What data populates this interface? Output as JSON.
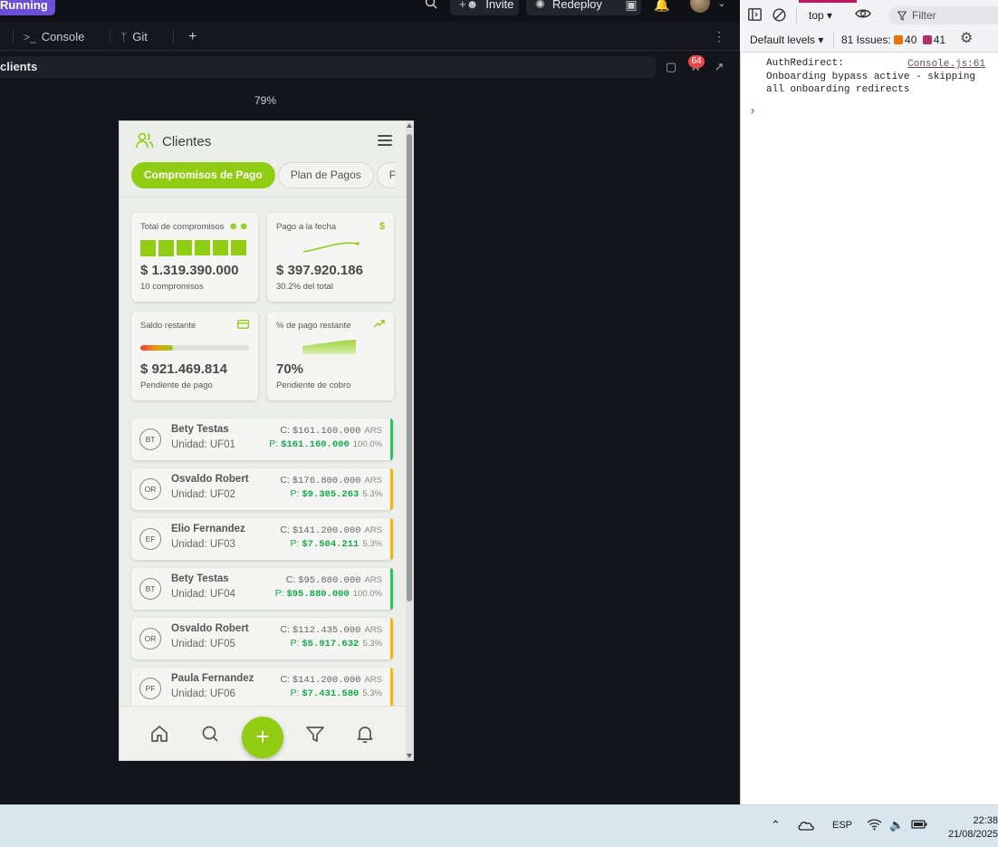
{
  "topbar": {
    "status": "Running",
    "invite_label": "Invite",
    "redeploy_label": "Redeploy"
  },
  "tabs": [
    {
      "label": "Console",
      "icon": "terminal-icon"
    },
    {
      "label": "Git",
      "icon": "git-icon"
    }
  ],
  "url": {
    "path": "clients",
    "badge_count": "64"
  },
  "preview": {
    "zoom": "79%"
  },
  "app": {
    "title": "Clientes",
    "brand_color": "#8fcc12",
    "pills": [
      "Compromisos de Pago",
      "Plan de Pagos",
      "Pag"
    ],
    "cards": {
      "total": {
        "label": "Total de compromisos",
        "value": "$ 1.319.390.000",
        "sub": "10 compromisos",
        "squares": 6
      },
      "paid": {
        "label": "Pago a la fecha",
        "value": "$ 397.920.186",
        "sub": "30.2% del total"
      },
      "remaining": {
        "label": "Saldo restante",
        "value": "$ 921.469.814",
        "sub": "Pendiente de pago",
        "progress_fraction": 0.3
      },
      "percent": {
        "label": "% de pago restante",
        "value": "70%",
        "sub": "Pendiente de cobro"
      }
    },
    "clients": [
      {
        "initials": "BT",
        "name": "Bety Testas",
        "unit": "Unidad: UF01",
        "c_label": "C:",
        "c_value": "$161.160.000",
        "currency": "ARS",
        "p_label": "P:",
        "p_value": "$161.160.000",
        "pct": "100.0%",
        "status_color": "#22c55e"
      },
      {
        "initials": "OR",
        "name": "Osvaldo Robert",
        "unit": "Unidad: UF02",
        "c_label": "C:",
        "c_value": "$176.800.000",
        "currency": "ARS",
        "p_label": "P:",
        "p_value": "$9.305.263",
        "pct": "5.3%",
        "status_color": "#f5b700"
      },
      {
        "initials": "EF",
        "name": "Elio Fernandez",
        "unit": "Unidad: UF03",
        "c_label": "C:",
        "c_value": "$141.200.000",
        "currency": "ARS",
        "p_label": "P:",
        "p_value": "$7.504.211",
        "pct": "5.3%",
        "status_color": "#f5b700"
      },
      {
        "initials": "BT",
        "name": "Bety Testas",
        "unit": "Unidad: UF04",
        "c_label": "C:",
        "c_value": "$95.880.000",
        "currency": "ARS",
        "p_label": "P:",
        "p_value": "$95.880.000",
        "pct": "100.0%",
        "status_color": "#22c55e"
      },
      {
        "initials": "OR",
        "name": "Osvaldo Robert",
        "unit": "Unidad: UF05",
        "c_label": "C:",
        "c_value": "$112.435.000",
        "currency": "ARS",
        "p_label": "P:",
        "p_value": "$5.917.632",
        "pct": "5.3%",
        "status_color": "#f5b700"
      },
      {
        "initials": "PF",
        "name": "Paula Fernandez",
        "unit": "Unidad: UF06",
        "c_label": "C:",
        "c_value": "$141.200.000",
        "currency": "ARS",
        "p_label": "P:",
        "p_value": "$7.431.580",
        "pct": "5.3%",
        "status_color": "#f5b700"
      }
    ],
    "bottom_nav": [
      "home-icon",
      "search-icon",
      "plus-icon",
      "filter-icon",
      "bell-icon"
    ]
  },
  "devtools": {
    "context": "top",
    "filter_placeholder": "Filter",
    "levels": "Default levels",
    "issues_label": "81 Issues:",
    "issues_errors": "40",
    "issues_messages": "41",
    "log": {
      "source": "Console.js:61",
      "line1": "AuthRedirect:",
      "line2": "Onboarding bypass active - skipping",
      "line3": "all onboarding redirects"
    }
  },
  "taskbar": {
    "language": "ESP",
    "time": "22:38",
    "date": "21/08/2025"
  }
}
